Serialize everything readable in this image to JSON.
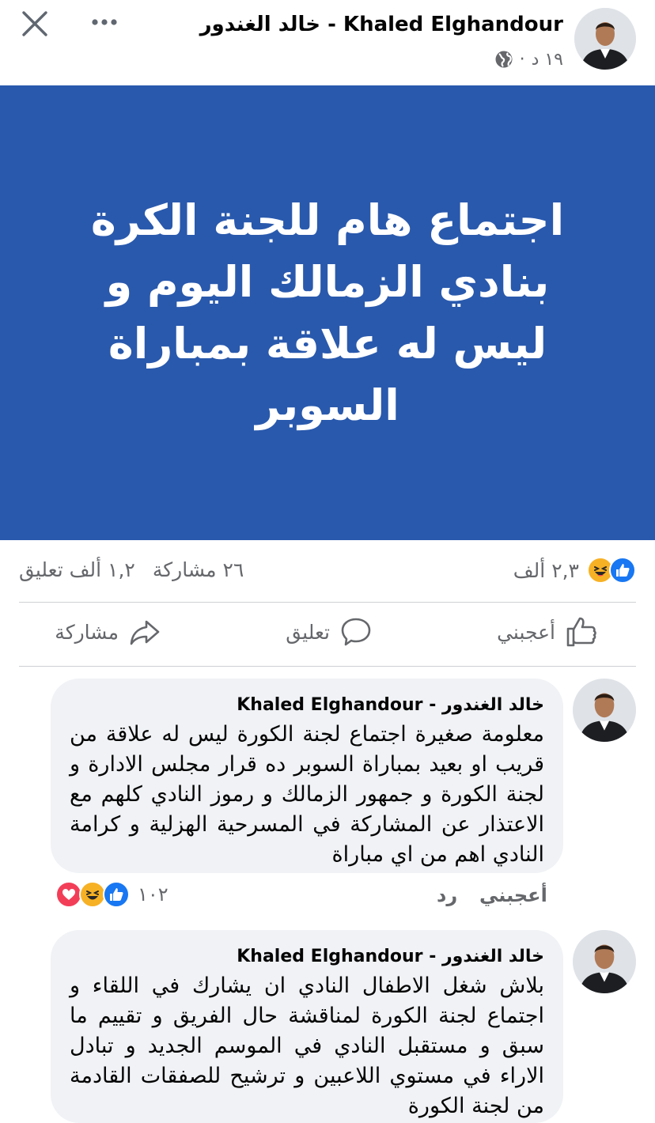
{
  "header": {
    "close_icon": "close-icon",
    "more_icon": "more-horizontal-icon",
    "author": "خالد الغندور - Khaled Elghandour",
    "time": "١٩ د",
    "dot": "·",
    "audience_icon": "globe-icon"
  },
  "post": {
    "banner_text": "اجتماع هام للجنة الكرة بنادي الزمالك اليوم و ليس له علاقة بمباراة السوبر",
    "banner_color": "#2959ad",
    "reactions_count": "٢,٣ ألف",
    "reaction_types": [
      "like",
      "haha"
    ],
    "shares_count": "٢٦ مشاركة",
    "comments_count": "١,٢ ألف تعليق"
  },
  "actions": {
    "like_label": "أعجبني",
    "comment_label": "تعليق",
    "share_label": "مشاركة"
  },
  "comments": [
    {
      "author": "خالد الغندور - Khaled Elghandour",
      "text": "معلومة صغيرة اجتماع لجنة الكورة ليس له علاقة من قريب او بعيد بمباراة السوبر ده قرار مجلس الادارة و لجنة الكورة و جمهور الزمالك و رموز النادي كلهم مع الاعتذار عن المشاركة في المسرحية الهزلية و كرامة النادي اهم من اي مباراة",
      "like_label": "أعجبني",
      "reply_label": "رد",
      "reactions_count": "١٠٢",
      "reaction_types": [
        "like",
        "haha",
        "love"
      ]
    },
    {
      "author": "خالد الغندور - Khaled Elghandour",
      "text": "بلاش شغل الاطفال النادي ان يشارك في اللقاء و اجتماع لجنة الكورة لمناقشة حال الفريق و تقييم ما سبق و مستقبل النادي في الموسم الجديد و تبادل الاراء في مستوي اللاعبين  و ترشيح للصفقات القادمة من لجنة الكورة"
    }
  ],
  "colors": {
    "like_blue": "#1877f2",
    "haha_yellow": "#f7b125",
    "love_red": "#f33e58",
    "secondary_text": "#65676b",
    "bubble_bg": "#f0f2f5"
  }
}
